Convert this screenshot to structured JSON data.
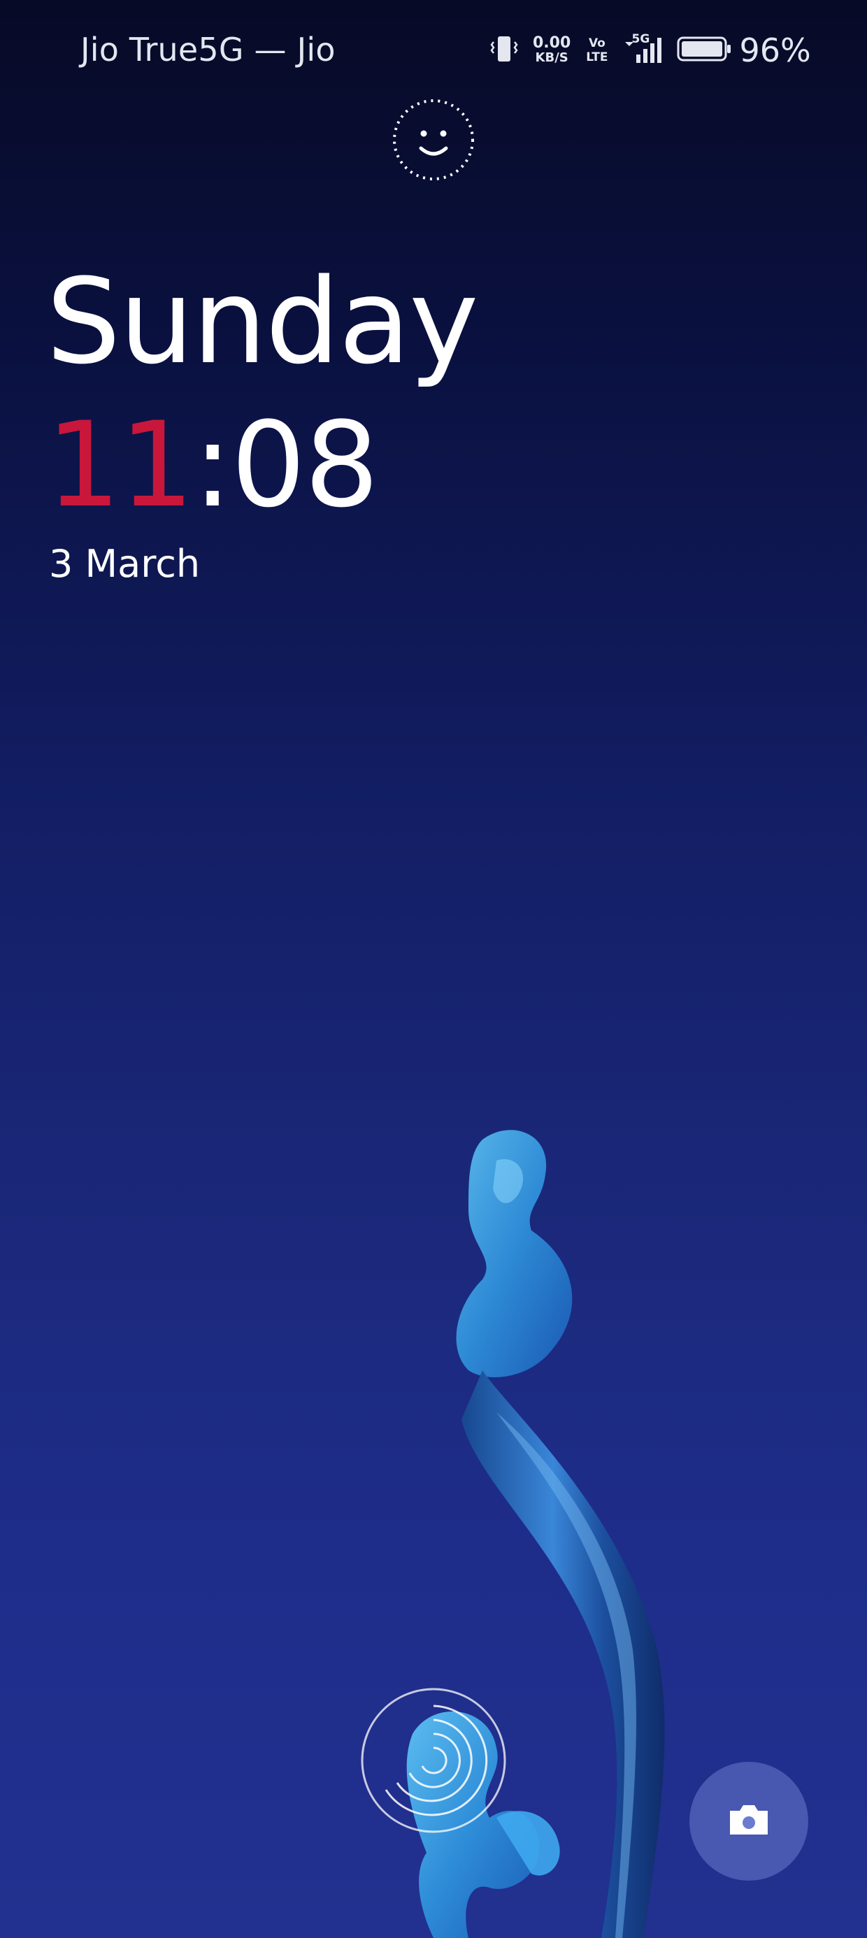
{
  "status_bar": {
    "carrier": "Jio True5G — Jio",
    "net_speed_value": "0.00",
    "net_speed_unit": "KB/S",
    "volte_top": "Vo",
    "volte_bottom": "LTE",
    "network_type": "5G",
    "battery_percent": "96%",
    "icons": [
      "vibrate-icon",
      "signal-icon",
      "battery-icon"
    ]
  },
  "face_unlock": {
    "icon": "face-unlock-icon"
  },
  "lockscreen": {
    "weekday": "Sunday",
    "time_hours": "11",
    "time_separator": ":",
    "time_minutes": "08",
    "date": "3 March"
  },
  "fingerprint": {
    "icon": "fingerprint-icon"
  },
  "camera_shortcut": {
    "icon": "camera-icon"
  },
  "colors": {
    "accent_hours": "#c8173b",
    "background_top": "#070a26",
    "background_bottom": "#22308f",
    "wallpaper_ribbon": "#3aa6ea"
  }
}
